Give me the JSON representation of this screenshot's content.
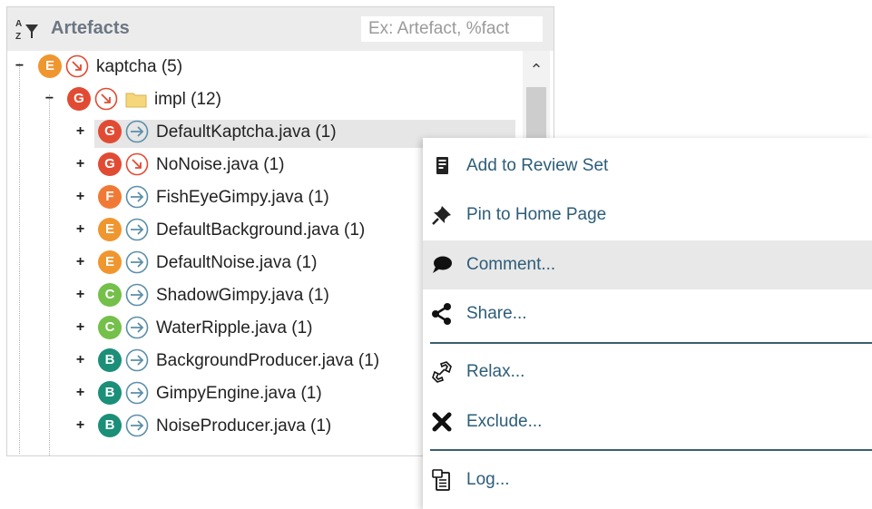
{
  "panel": {
    "title": "Artefacts",
    "filter_placeholder": "Ex: Artefact, %fact",
    "sort_icon": "sort-alpha-filter-icon"
  },
  "tree": {
    "root": {
      "badge": "E",
      "trend": "down",
      "label": "kaptcha (5)"
    },
    "folder": {
      "badge": "G",
      "trend": "down",
      "label": "impl (12)"
    },
    "items": [
      {
        "badge": "G",
        "trend": "right",
        "label": "DefaultKaptcha.java (1)",
        "selected": true
      },
      {
        "badge": "G",
        "trend": "down",
        "label": "NoNoise.java (1)"
      },
      {
        "badge": "F",
        "trend": "right",
        "label": "FishEyeGimpy.java (1)"
      },
      {
        "badge": "E",
        "trend": "right",
        "label": "DefaultBackground.java (1)"
      },
      {
        "badge": "E",
        "trend": "right",
        "label": "DefaultNoise.java (1)"
      },
      {
        "badge": "C",
        "trend": "right",
        "label": "ShadowGimpy.java (1)"
      },
      {
        "badge": "C",
        "trend": "right",
        "label": "WaterRipple.java (1)"
      },
      {
        "badge": "B",
        "trend": "right",
        "label": "BackgroundProducer.java (1)"
      },
      {
        "badge": "B",
        "trend": "right",
        "label": "GimpyEngine.java (1)"
      },
      {
        "badge": "B",
        "trend": "right",
        "label": "NoiseProducer.java (1)"
      }
    ]
  },
  "colors": {
    "E": "#f0962f",
    "G": "#e24b33",
    "F": "#f07a35",
    "C": "#74c04a",
    "B": "#1b8f78",
    "menu_text": "#2d5d79",
    "header_text": "#6b7782"
  },
  "context_menu": {
    "items": [
      {
        "icon": "review-set-icon",
        "label": "Add to Review Set"
      },
      {
        "icon": "pin-icon",
        "label": "Pin to Home Page"
      },
      {
        "icon": "comment-icon",
        "label": "Comment...",
        "hover": true
      },
      {
        "icon": "share-icon",
        "label": "Share..."
      },
      {
        "icon": "relax-icon",
        "label": "Relax..."
      },
      {
        "icon": "exclude-icon",
        "label": "Exclude..."
      },
      {
        "icon": "log-icon",
        "label": "Log..."
      }
    ]
  }
}
